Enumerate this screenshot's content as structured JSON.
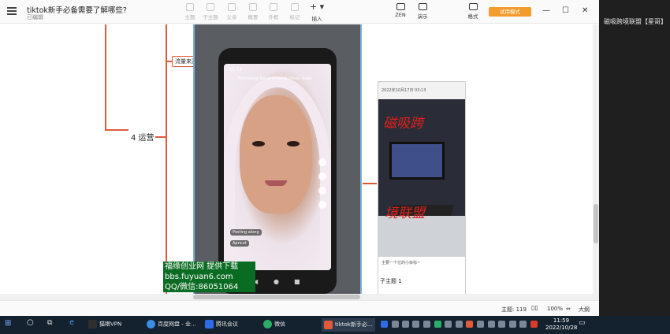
{
  "window": {
    "title": "tiktok新手必备需要了解哪些?",
    "subtitle": "已编辑"
  },
  "toolbar": {
    "items": [
      {
        "label": "主题"
      },
      {
        "label": "子主题"
      },
      {
        "label": "父亲"
      },
      {
        "label": "概要"
      },
      {
        "label": "外框"
      },
      {
        "label": "标记"
      }
    ],
    "insert_label": "插入",
    "zen_label": "ZEN",
    "present_label": "演示",
    "format_label": "格式",
    "try_button": "试用模式"
  },
  "window_controls": {
    "minimize": "—",
    "maximize": "☐",
    "close": "✕"
  },
  "mindmap": {
    "node_main": "4 运营",
    "node_traffic": "流量来源",
    "sub_topic": "子主题 1"
  },
  "phone_video": {
    "status_time": "10:01",
    "tabs": "Following   Recommend   Qmer Arde",
    "chip1": "Posting along",
    "chip2": "Apricot"
  },
  "screenshot_thumb": {
    "header_date": "2022年10月17日 03:13",
    "handwriting_1": "磁吸跨",
    "handwriting_2": "境联盟",
    "caption": "主要一个亿的小目标~"
  },
  "watermark": {
    "line1": "福缘创业网 提供下载",
    "line2": "bbs.fuyuan6.com",
    "line3": "QQ/微信:86051064"
  },
  "right_panel": {
    "label": "磁吸跨境联盟【星哥】"
  },
  "statusbar": {
    "topic_count": "主题: 119",
    "zoom": "100%",
    "outline": "大纲"
  },
  "taskbar": {
    "apps": [
      {
        "label": "猫眼VPN",
        "color": "#2f2f2f"
      },
      {
        "label": "百度网盘 - 全...",
        "color": "#3a8ee6"
      },
      {
        "label": "腾讯会议",
        "color": "#2f6be6"
      },
      {
        "label": "微信",
        "color": "#2aae67"
      },
      {
        "label": "tiktok新手必...",
        "color": "#e05a3a"
      }
    ],
    "time": "11:59",
    "date": "2022/10/28"
  },
  "colors": {
    "branch": "#e05a3a",
    "accent": "#f39b2b",
    "taskbar": "#14212e"
  }
}
